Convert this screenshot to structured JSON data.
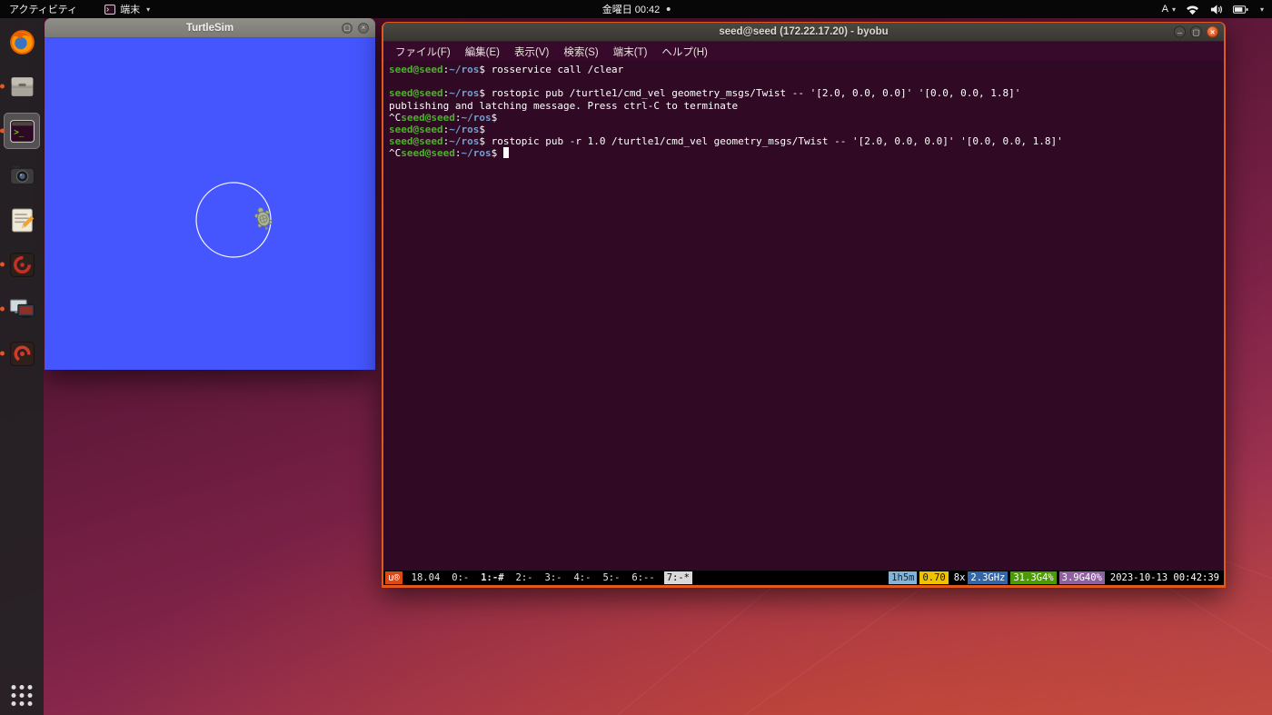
{
  "colors": {
    "accent_orange": "#e0591f",
    "terminal_bg": "#300a24",
    "prompt_user_green": "#4fae2f",
    "prompt_path_blue": "#729fcf",
    "turtlesim_blue": "#4556ff"
  },
  "topbar": {
    "activities": "アクティビティ",
    "focused_app": "端末",
    "clock": "金曜日 00:42",
    "input_indicator": "A"
  },
  "dock": {
    "items": [
      {
        "id": "firefox",
        "icon": "firefox-icon",
        "running": false,
        "active": false
      },
      {
        "id": "files",
        "icon": "files-icon",
        "running": true,
        "active": false
      },
      {
        "id": "terminal",
        "icon": "terminal-icon",
        "running": true,
        "active": true
      },
      {
        "id": "screenshot",
        "icon": "screenshot-icon",
        "running": false,
        "active": false
      },
      {
        "id": "text-editor",
        "icon": "text-editor-icon",
        "running": false,
        "active": false
      },
      {
        "id": "ros-app",
        "icon": "ros-app-icon",
        "running": true,
        "active": false
      },
      {
        "id": "remote-desktop",
        "icon": "remote-desktop-icon",
        "running": true,
        "active": false
      },
      {
        "id": "ros-app-2",
        "icon": "ros-app2-icon",
        "running": true,
        "active": false
      }
    ]
  },
  "turtlesim": {
    "title": "TurtleSim"
  },
  "terminal": {
    "title": "seed@seed (172.22.17.20) - byobu",
    "menu_items": [
      "ファイル(F)",
      "編集(E)",
      "表示(V)",
      "検索(S)",
      "端末(T)",
      "ヘルプ(H)"
    ],
    "prompt": {
      "user_host": "seed@seed",
      "separator": ":",
      "path": "~/ros",
      "symbol": "$"
    },
    "lines": [
      {
        "type": "prompt",
        "command": "rosservice call /clear"
      },
      {
        "type": "blank"
      },
      {
        "type": "prompt",
        "command": "rostopic pub /turtle1/cmd_vel geometry_msgs/Twist -- '[2.0, 0.0, 0.0]' '[0.0, 0.0, 1.8]'"
      },
      {
        "type": "output",
        "text": "publishing and latching message. Press ctrl-C to terminate"
      },
      {
        "type": "prompt",
        "prefix": "^C",
        "command": ""
      },
      {
        "type": "prompt",
        "command": ""
      },
      {
        "type": "prompt",
        "command": "rostopic pub -r 1.0 /turtle1/cmd_vel geometry_msgs/Twist -- '[2.0, 0.0, 0.0]' '[0.0, 0.0, 1.8]'"
      },
      {
        "type": "prompt",
        "prefix": "^C",
        "command": "",
        "cursor": true
      }
    ],
    "statusbar": {
      "left": [
        {
          "name": "ubuntu-logo",
          "text": "u®",
          "bg": "#dd4814",
          "fg": "#ffffff"
        },
        {
          "name": "release",
          "text": "18.04"
        },
        {
          "name": "window-0",
          "text": "0:-"
        },
        {
          "name": "window-1",
          "text": "1:-#",
          "bold": true
        },
        {
          "name": "window-2",
          "text": "2:-"
        },
        {
          "name": "window-3",
          "text": "3:-"
        },
        {
          "name": "window-4",
          "text": "4:-"
        },
        {
          "name": "window-5",
          "text": "5:-"
        },
        {
          "name": "window-6",
          "text": "6:--"
        },
        {
          "name": "window-7-current",
          "text": "7:-*",
          "bg": "#d9d9d9",
          "fg": "#000000"
        }
      ],
      "right": [
        {
          "name": "uptime",
          "text": "1h5m",
          "bg": "#84b5d9",
          "fg": "#102430"
        },
        {
          "name": "load-average",
          "text": "0.70",
          "bg": "#f0c300",
          "fg": "#1f1900"
        },
        {
          "name": "cpu-count",
          "text": "8x",
          "fg": "#ffffff"
        },
        {
          "name": "cpu-frequency",
          "text": "2.3GHz",
          "bg": "#3465a4",
          "fg": "#ffffff",
          "joined": true
        },
        {
          "name": "memory",
          "text": "31.3G4%",
          "bg": "#4e9a06",
          "fg": "#ffffff"
        },
        {
          "name": "swap",
          "text": "3.9G40%",
          "bg": "#9061a0",
          "fg": "#ffffff"
        },
        {
          "name": "datetime",
          "text": "2023-10-13 00:42:39",
          "fg": "#ffffff"
        }
      ]
    }
  }
}
